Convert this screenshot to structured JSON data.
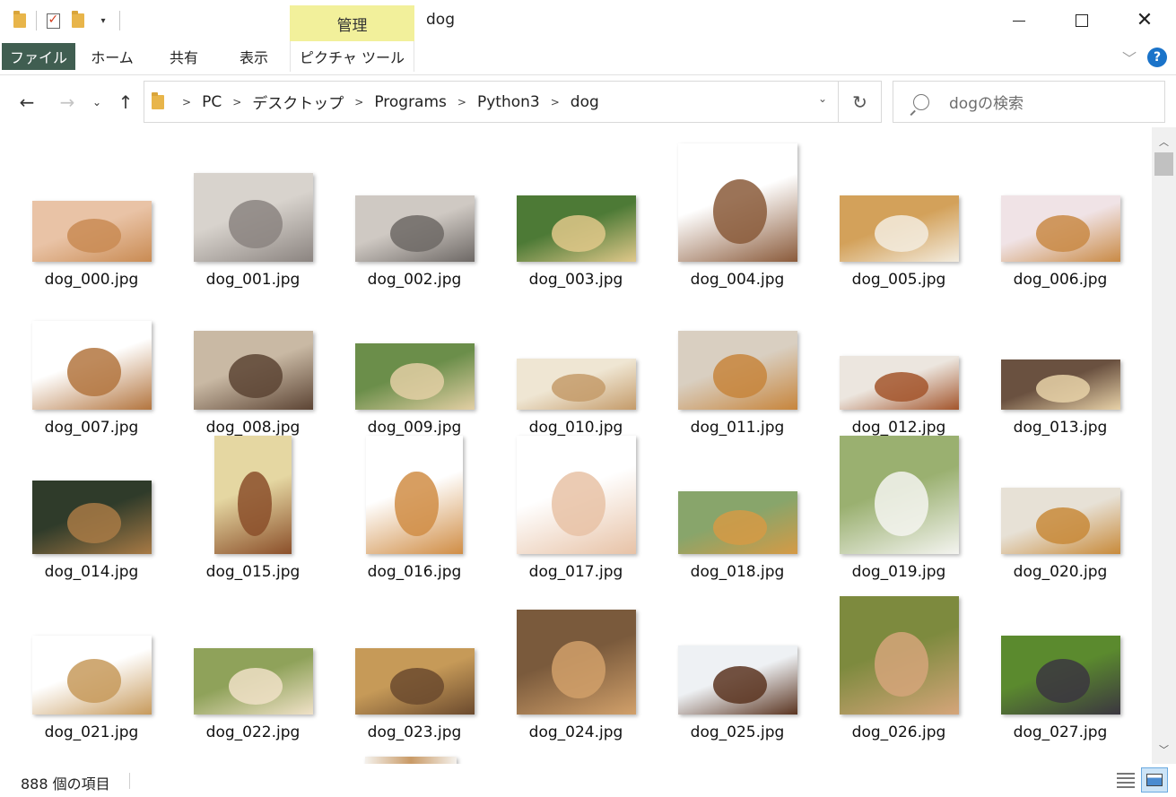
{
  "window": {
    "title": "dog",
    "manage_tab": "管理"
  },
  "ribbon": {
    "tabs": [
      {
        "label": "ファイル"
      },
      {
        "label": "ホーム"
      },
      {
        "label": "共有"
      },
      {
        "label": "表示"
      },
      {
        "label": "ピクチャ ツール"
      }
    ]
  },
  "address": {
    "segments": [
      "PC",
      "デスクトップ",
      "Programs",
      "Python3",
      "dog"
    ]
  },
  "search": {
    "placeholder": "dogの検索"
  },
  "files": [
    {
      "name": "dog_000.jpg",
      "colors": [
        "#e9c3a6",
        "#c98b53"
      ]
    },
    {
      "name": "dog_001.jpg",
      "colors": [
        "#d8d3cd",
        "#8b8480"
      ]
    },
    {
      "name": "dog_002.jpg",
      "colors": [
        "#cfc9c3",
        "#6d6865"
      ]
    },
    {
      "name": "dog_003.jpg",
      "colors": [
        "#4d7a36",
        "#e0c88a"
      ]
    },
    {
      "name": "dog_004.jpg",
      "colors": [
        "#ffffff",
        "#8a5a3a"
      ]
    },
    {
      "name": "dog_005.jpg",
      "colors": [
        "#d3a15a",
        "#f3ecdf"
      ]
    },
    {
      "name": "dog_006.jpg",
      "colors": [
        "#f0e3e6",
        "#c98a45"
      ]
    },
    {
      "name": "dog_007.jpg",
      "colors": [
        "#ffffff",
        "#b3753f"
      ]
    },
    {
      "name": "dog_008.jpg",
      "colors": [
        "#c9b9a4",
        "#5c4434"
      ]
    },
    {
      "name": "dog_009.jpg",
      "colors": [
        "#6b8e4a",
        "#e3cfa4"
      ]
    },
    {
      "name": "dog_010.jpg",
      "colors": [
        "#efe6d3",
        "#c49b6a"
      ]
    },
    {
      "name": "dog_011.jpg",
      "colors": [
        "#d9cfc1",
        "#c7853c"
      ]
    },
    {
      "name": "dog_012.jpg",
      "colors": [
        "#ece6df",
        "#a3552c"
      ]
    },
    {
      "name": "dog_013.jpg",
      "colors": [
        "#6a5140",
        "#e8d2a8"
      ]
    },
    {
      "name": "dog_014.jpg",
      "colors": [
        "#2f3b2a",
        "#a87a45"
      ]
    },
    {
      "name": "dog_015.jpg",
      "colors": [
        "#e5d7a2",
        "#8b4f2a"
      ]
    },
    {
      "name": "dog_016.jpg",
      "colors": [
        "#ffffff",
        "#d08d45"
      ]
    },
    {
      "name": "dog_017.jpg",
      "colors": [
        "#ffffff",
        "#e7c2a6"
      ]
    },
    {
      "name": "dog_018.jpg",
      "colors": [
        "#88a56b",
        "#d59a45"
      ]
    },
    {
      "name": "dog_019.jpg",
      "colors": [
        "#9ab070",
        "#f4f4f0"
      ]
    },
    {
      "name": "dog_020.jpg",
      "colors": [
        "#e7e1d6",
        "#c88a3a"
      ]
    },
    {
      "name": "dog_021.jpg",
      "colors": [
        "#ffffff",
        "#c79a5c"
      ]
    },
    {
      "name": "dog_022.jpg",
      "colors": [
        "#8fa25a",
        "#f0e1c7"
      ]
    },
    {
      "name": "dog_023.jpg",
      "colors": [
        "#c69a58",
        "#6b4a2e"
      ]
    },
    {
      "name": "dog_024.jpg",
      "colors": [
        "#7a5a3c",
        "#d1a06a"
      ]
    },
    {
      "name": "dog_025.jpg",
      "colors": [
        "#eef1f4",
        "#5a3420"
      ]
    },
    {
      "name": "dog_026.jpg",
      "colors": [
        "#7d8a3e",
        "#d5a57a"
      ]
    },
    {
      "name": "dog_027.jpg",
      "colors": [
        "#5b8a2e",
        "#3b3640"
      ]
    }
  ],
  "status": {
    "item_count": "888 個の項目"
  }
}
